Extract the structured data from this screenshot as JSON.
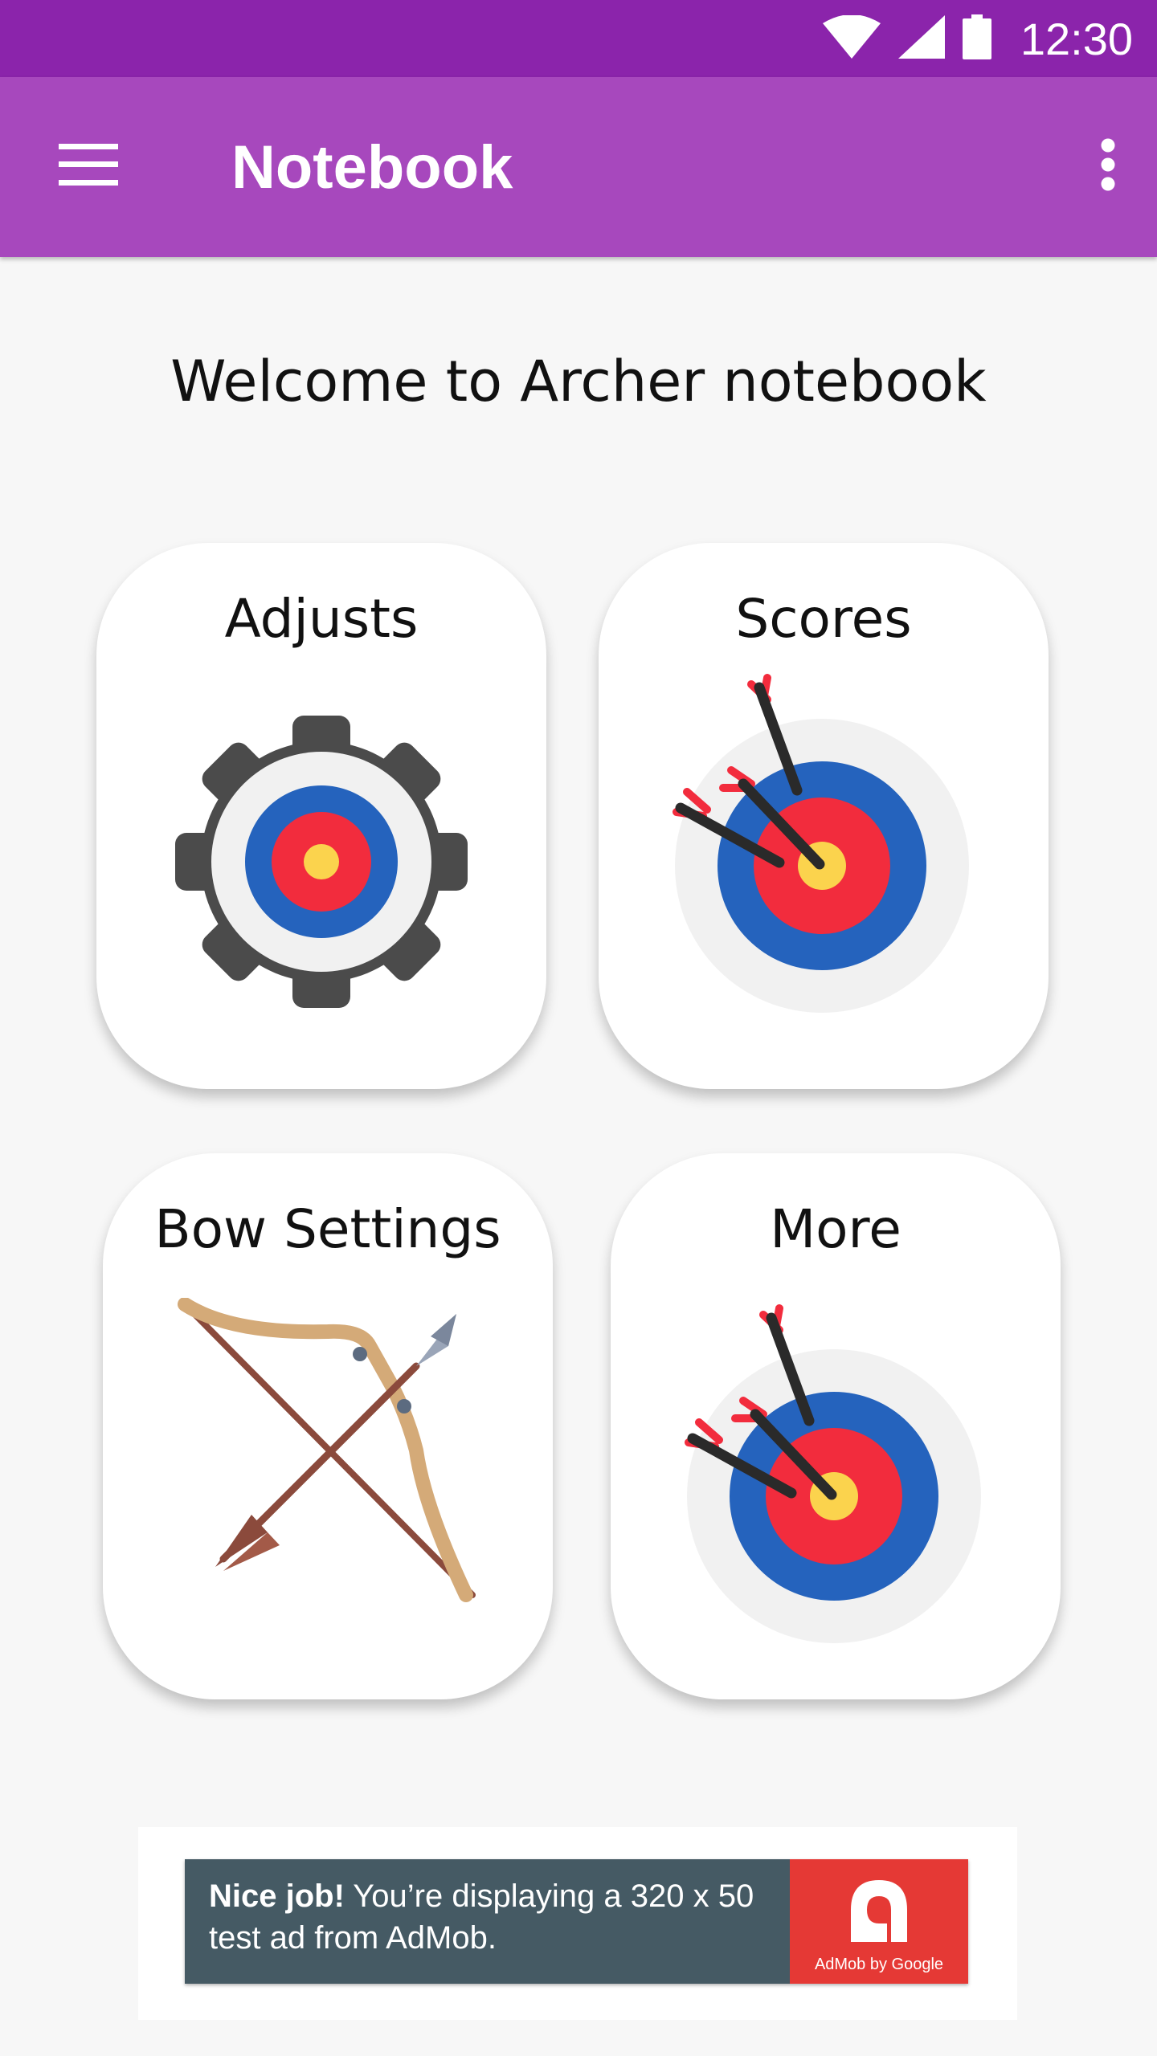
{
  "status_bar": {
    "time": "12:30",
    "icons": [
      "wifi-icon",
      "cell-signal-icon",
      "battery-icon"
    ]
  },
  "app_bar": {
    "title": "Notebook",
    "menu_icon": "hamburger-menu-icon",
    "overflow_icon": "more-vert-icon"
  },
  "welcome": "Welcome to Archer notebook",
  "tiles": [
    {
      "label": "Adjusts",
      "icon": "gear-target-icon"
    },
    {
      "label": "Scores",
      "icon": "target-arrows-icon"
    },
    {
      "label": "Bow Settings",
      "icon": "bow-arrow-icon"
    },
    {
      "label": "More",
      "icon": "target-arrows-icon"
    }
  ],
  "ad": {
    "headline": "Nice job!",
    "body": " You’re displaying a 320 x 50 test ad from AdMob.",
    "logo_caption": "AdMob by Google"
  },
  "colors": {
    "status_bar": "#8b24ab",
    "app_bar": "#a748bd",
    "target_blue": "#2563bd",
    "target_red": "#f22c3d",
    "target_yellow": "#fbd34d",
    "ad_background": "#455a64",
    "ad_logo": "#e53935"
  }
}
